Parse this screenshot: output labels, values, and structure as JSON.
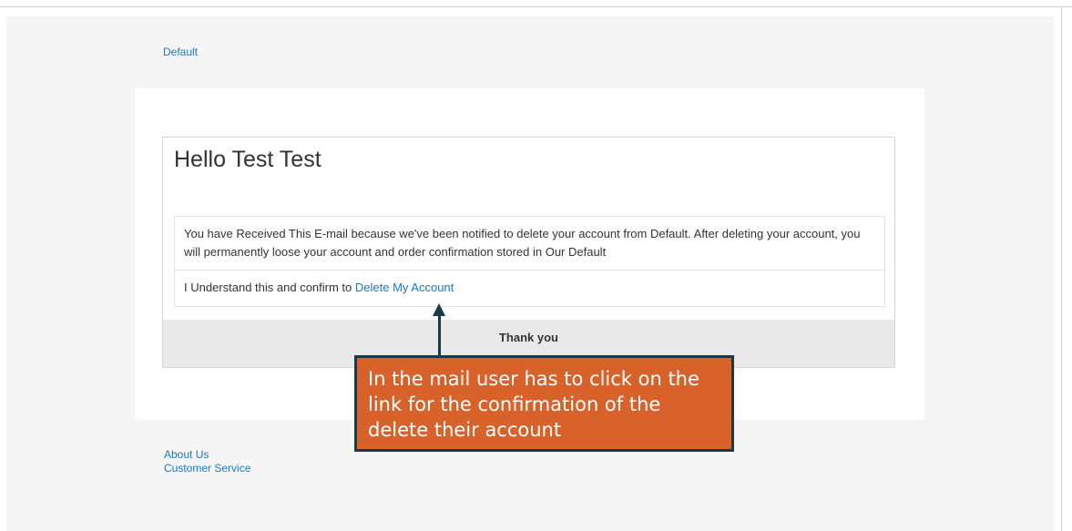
{
  "store": {
    "name": "Default"
  },
  "email": {
    "greeting": "Hello Test Test",
    "notice_text": "You have Received This E-mail because we've been notified to delete your account from Default. After deleting your account, you will permanently loose your account and order confirmation stored in Our Default",
    "confirm_prefix": "I Understand this and confirm to ",
    "confirm_link_label": "Delete My Account",
    "thanks_text": "Thank you"
  },
  "footer": {
    "links": [
      "About Us",
      "Customer Service"
    ]
  },
  "annotation": {
    "callout_text": "In the mail user has to click on the link for the confirmation of the delete their account"
  },
  "colors": {
    "link": "#1979c3",
    "callout_bg": "#d9622b",
    "callout_border": "#1a3a4a"
  }
}
